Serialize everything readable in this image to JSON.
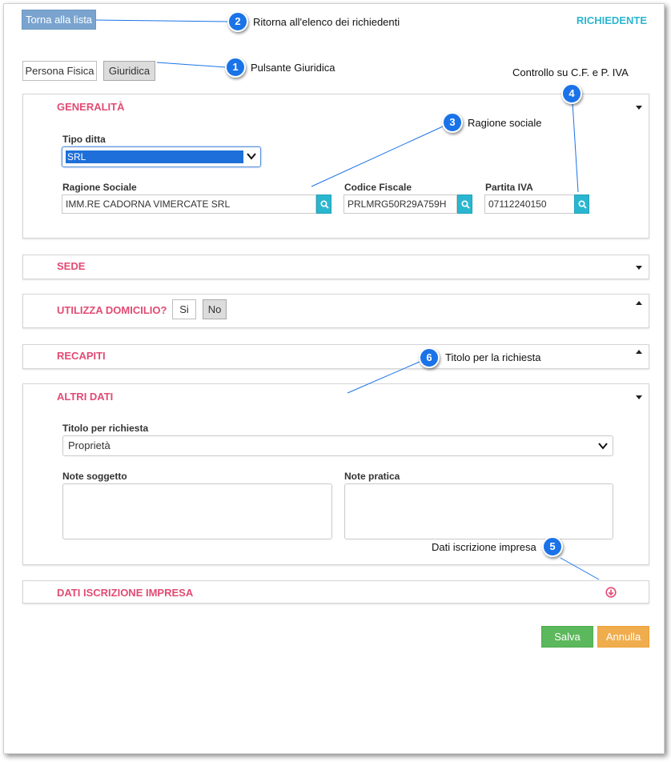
{
  "header": {
    "back_button": "Torna alla lista",
    "section_title": "RICHIEDENTE"
  },
  "person_type": {
    "fisica": "Persona Fisica",
    "giuridica": "Giuridica"
  },
  "generalita": {
    "title": "GENERALITÀ",
    "tipo_ditta_label": "Tipo ditta",
    "tipo_ditta_value": "SRL",
    "ragione_sociale_label": "Ragione Sociale",
    "ragione_sociale_value": "IMM.RE CADORNA VIMERCATE SRL",
    "codice_fiscale_label": "Codice Fiscale",
    "codice_fiscale_value": "PRLMRG50R29A759H",
    "partita_iva_label": "Partita IVA",
    "partita_iva_value": "07112240150"
  },
  "sede": {
    "title": "SEDE"
  },
  "domicilio": {
    "title": "UTILIZZA DOMICILIO?",
    "si": "Si",
    "no": "No"
  },
  "recapiti": {
    "title": "RECAPITI"
  },
  "altri_dati": {
    "title": "ALTRI DATI",
    "titolo_label": "Titolo per richiesta",
    "titolo_value": "Proprietà",
    "note_soggetto_label": "Note soggetto",
    "note_pratica_label": "Note pratica"
  },
  "iscrizione": {
    "title": "DATI ISCRIZIONE IMPRESA"
  },
  "actions": {
    "save": "Salva",
    "cancel": "Annulla"
  },
  "annotations": [
    {
      "number": "1",
      "text": "Pulsante Giuridica"
    },
    {
      "number": "2",
      "text": "Ritorna all'elenco dei richiedenti"
    },
    {
      "number": "3",
      "text": "Ragione sociale"
    },
    {
      "number": "4",
      "text": "Controllo su C.F. e P. IVA"
    },
    {
      "number": "5",
      "text": "Dati iscrizione impresa"
    },
    {
      "number": "6",
      "text": "Titolo per la richiesta"
    }
  ],
  "colors": {
    "accent_title": "#e24b73",
    "brand_cyan": "#2bb6cf",
    "badge_blue": "#1a73e8",
    "save_green": "#5cb85c",
    "cancel_orange": "#f0ad4e"
  }
}
